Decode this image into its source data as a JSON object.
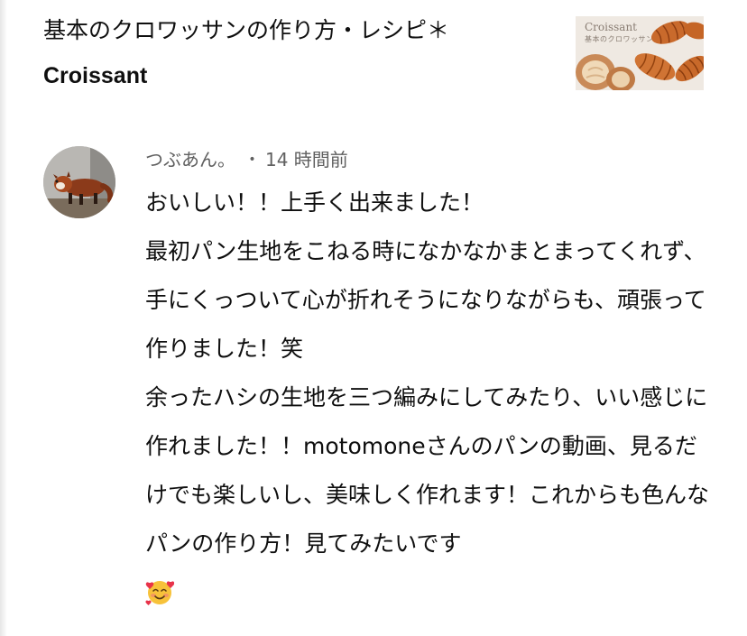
{
  "video": {
    "title_line1": "基本のクロワッサンの作り方・レシピ＊",
    "title_line2": "Croissant",
    "thumbnail": {
      "text": "Croissant",
      "subtext": "基本のクロワッサン"
    }
  },
  "comment": {
    "author": "つぶあん。",
    "separator": "•",
    "timestamp": "14 時間前",
    "text": "おいしい！！上手く出来ました！\n最初パン生地をこねる時になかなかまとまってくれず、手にくっついて心が折れそうになりながらも、頑張って作りました！笑\n余ったハシの生地を三つ編みにしてみたり、いい感じに作れました！！motomoneさんのパンの動画、見るだけでも楽しいし、美味しく作れます！これからも色んなパンの作り方！見てみたいです",
    "emoji": "smiling-face-with-hearts"
  },
  "colors": {
    "text_primary": "#0f0f0f",
    "text_secondary": "#606060",
    "background": "#ffffff"
  }
}
